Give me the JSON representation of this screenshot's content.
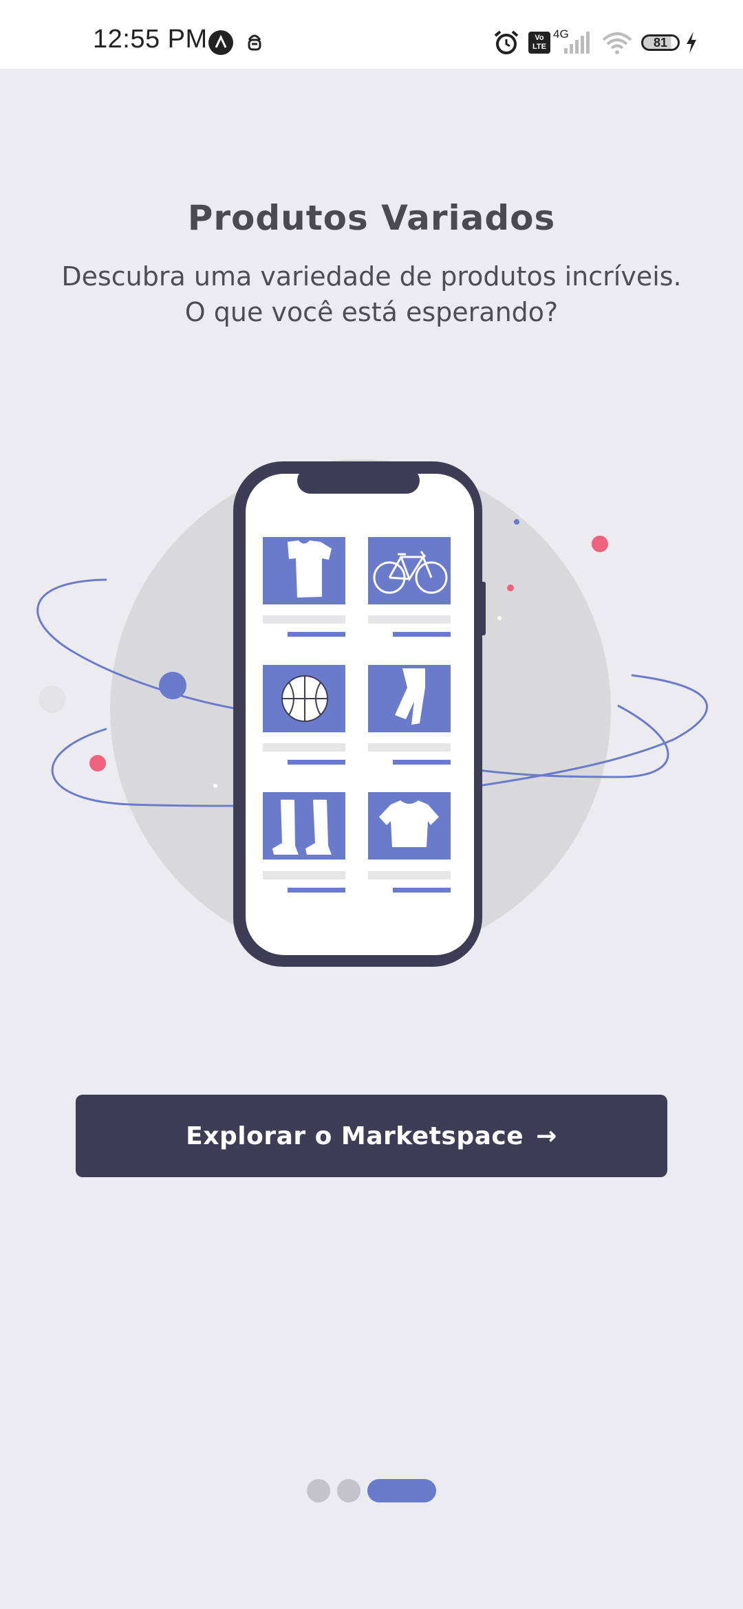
{
  "status_bar": {
    "time": "12:55 PM",
    "network": "4G",
    "volte": "Vo LTE",
    "battery": "81",
    "icons": [
      "app-a-icon",
      "notification-bug-icon",
      "alarm-icon",
      "volte-icon",
      "signal-icon",
      "wifi-icon",
      "battery-icon",
      "charging-icon"
    ]
  },
  "onboarding": {
    "title": "Produtos Variados",
    "subtitle_line1": "Descubra uma variedade de produtos incríveis.",
    "subtitle_line2": "O que você está esperando?",
    "button_label": "Explorar o Marketspace",
    "button_icon": "arrow-right-icon",
    "pager": {
      "total": 3,
      "active_index": 2
    }
  },
  "illustration": {
    "product_icons": [
      "tshirt-icon",
      "bicycle-icon",
      "basketball-icon",
      "pants-icon",
      "boots-icon",
      "shirt-icon"
    ],
    "colors": {
      "accent": "#6A7BCC",
      "dark": "#3F3D56",
      "pink": "#F0617E",
      "circle": "#D9D9DB"
    }
  },
  "colors": {
    "background": "#ECECF0",
    "button": "#3F3D56",
    "text": "#4A4A4F"
  }
}
